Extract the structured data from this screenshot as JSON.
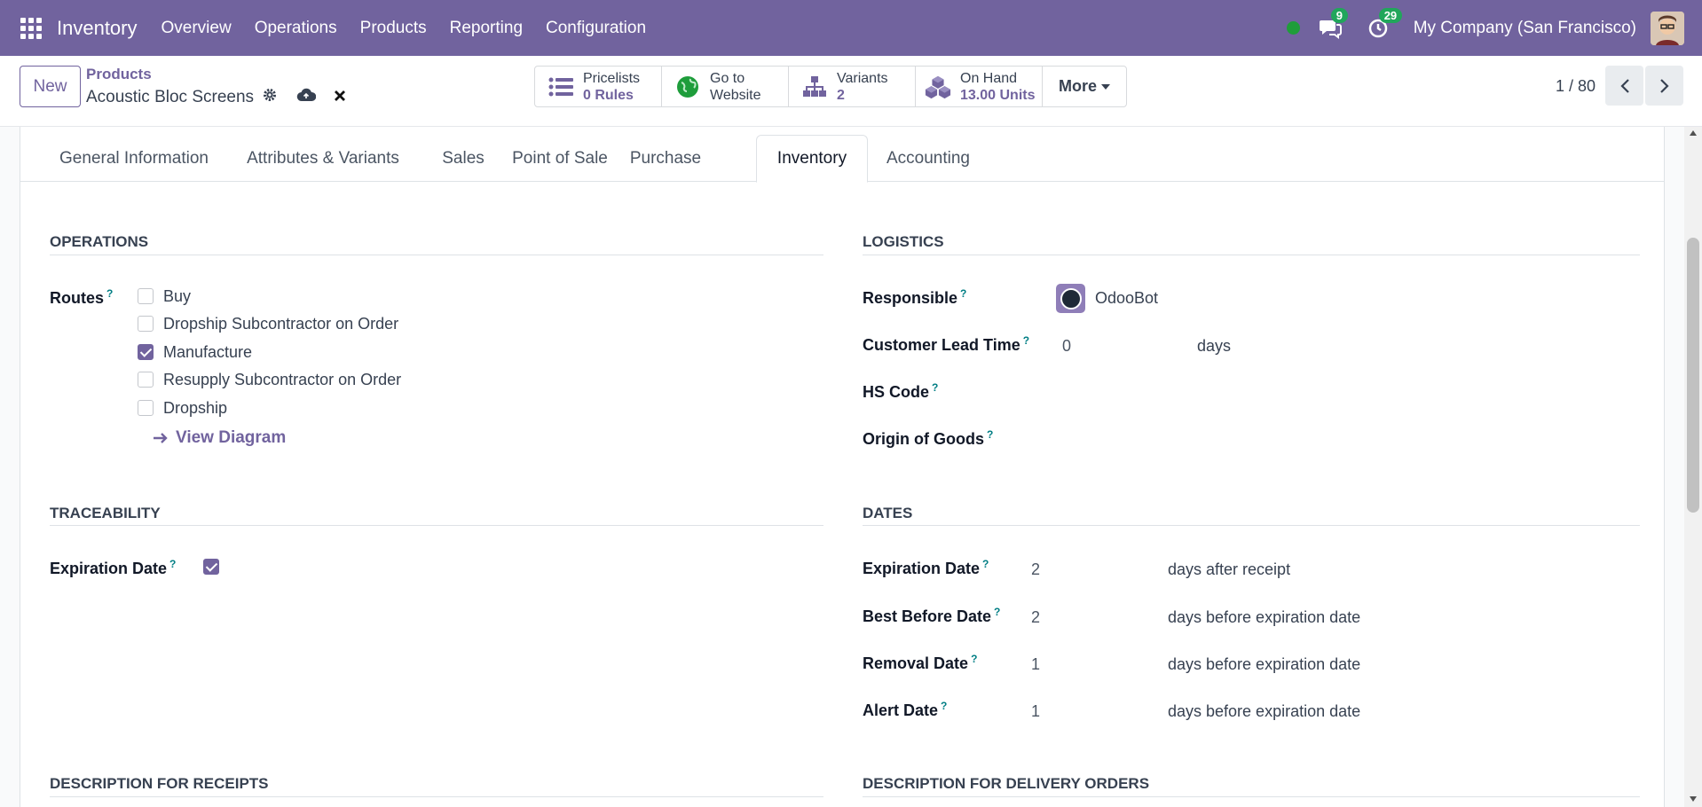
{
  "navbar": {
    "brand": "Inventory",
    "menu": [
      "Overview",
      "Operations",
      "Products",
      "Reporting",
      "Configuration"
    ],
    "chat_count": "9",
    "activity_count": "29",
    "company": "My Company (San Francisco)"
  },
  "control": {
    "new_label": "New",
    "breadcrumb": "Products",
    "record_title": "Acoustic Bloc Screens",
    "smart_buttons": {
      "pricelists": {
        "title": "Pricelists",
        "value": "0 Rules"
      },
      "website": {
        "line1": "Go to",
        "line2": "Website"
      },
      "variants": {
        "title": "Variants",
        "value": "2"
      },
      "on_hand": {
        "title": "On Hand",
        "value": "13.00 Units"
      }
    },
    "more_label": "More",
    "pager": "1 / 80"
  },
  "tabs": [
    "General Information",
    "Attributes & Variants",
    "Sales",
    "Point of Sale",
    "Purchase",
    "Inventory",
    "Accounting"
  ],
  "operations": {
    "title": "OPERATIONS",
    "routes_label": "Routes",
    "routes": [
      {
        "label": "Buy",
        "checked": false
      },
      {
        "label": "Dropship Subcontractor on Order",
        "checked": false
      },
      {
        "label": "Manufacture",
        "checked": true
      },
      {
        "label": "Resupply Subcontractor on Order",
        "checked": false
      },
      {
        "label": "Dropship",
        "checked": false
      }
    ],
    "view_diagram": "View Diagram"
  },
  "logistics": {
    "title": "LOGISTICS",
    "responsible_label": "Responsible",
    "responsible_value": "OdooBot",
    "lead_time_label": "Customer Lead Time",
    "lead_time_value": "0",
    "lead_time_unit": "days",
    "hs_code_label": "HS Code",
    "origin_label": "Origin of Goods"
  },
  "traceability": {
    "title": "TRACEABILITY",
    "expiration_label": "Expiration Date",
    "expiration_checked": true
  },
  "dates": {
    "title": "DATES",
    "rows": [
      {
        "label": "Expiration Date",
        "value": "2",
        "unit": "days after receipt"
      },
      {
        "label": "Best Before Date",
        "value": "2",
        "unit": "days before expiration date"
      },
      {
        "label": "Removal Date",
        "value": "1",
        "unit": "days before expiration date"
      },
      {
        "label": "Alert Date",
        "value": "1",
        "unit": "days before expiration date"
      }
    ]
  },
  "desc_receipts": "DESCRIPTION FOR RECEIPTS",
  "desc_delivery": "DESCRIPTION FOR DELIVERY ORDERS",
  "help_mark": "?"
}
